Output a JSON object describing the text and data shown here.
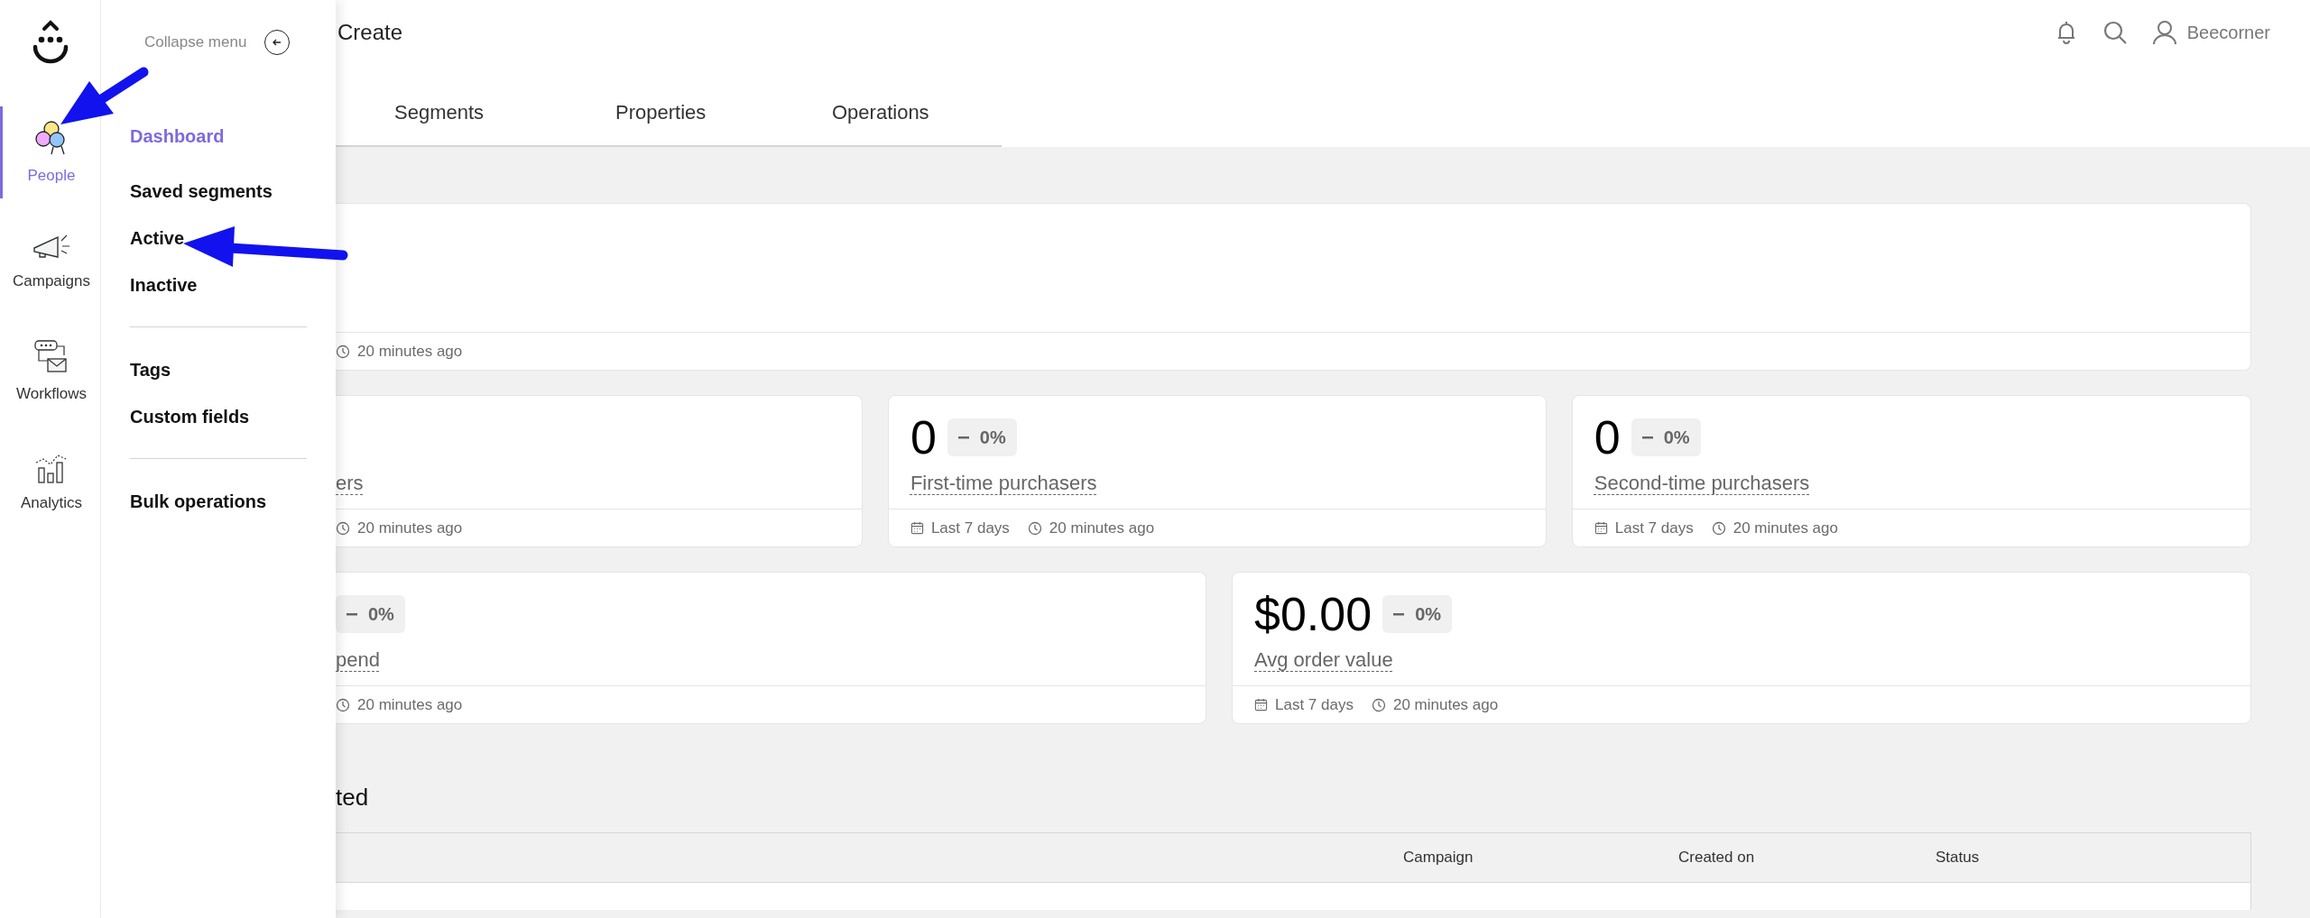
{
  "rail": [
    {
      "label": "People",
      "kind": "people",
      "selected": true
    },
    {
      "label": "Campaigns",
      "kind": "campaigns",
      "selected": false
    },
    {
      "label": "Workflows",
      "kind": "workflows",
      "selected": false
    },
    {
      "label": "Analytics",
      "kind": "analytics",
      "selected": false
    }
  ],
  "flyout": {
    "collapse_label": "Collapse menu",
    "groups": [
      [
        {
          "label": "Dashboard",
          "selected": true
        },
        {
          "label": "Saved segments",
          "selected": false
        },
        {
          "label": "Active",
          "selected": false
        },
        {
          "label": "Inactive",
          "selected": false
        }
      ],
      [
        {
          "label": "Tags",
          "selected": false
        },
        {
          "label": "Custom fields",
          "selected": false
        }
      ],
      [
        {
          "label": "Bulk operations",
          "selected": false
        }
      ]
    ]
  },
  "header": {
    "title": "Create",
    "user": "Beecorner"
  },
  "tabs": [
    {
      "label": "Segments",
      "selected": false
    },
    {
      "label": "Properties",
      "selected": false
    },
    {
      "label": "Operations",
      "selected": false
    }
  ],
  "card_rows": [
    [
      {
        "cut": true,
        "updated": "20 minutes ago"
      }
    ],
    [
      {
        "cut": true,
        "label": "ers",
        "updated": "20 minutes ago"
      },
      {
        "cut": false,
        "value": "0",
        "change": "0%",
        "label": "First-time purchasers",
        "period": "Last 7 days",
        "updated": "20 minutes ago"
      },
      {
        "cut": false,
        "value": "0",
        "change": "0%",
        "label": "Second-time purchasers",
        "period": "Last 7 days",
        "updated": "20 minutes ago"
      }
    ],
    [
      {
        "cut": true,
        "change": "0%",
        "label": "pend",
        "updated": "20 minutes ago"
      },
      {
        "cut": false,
        "value": "$0.00",
        "change": "0%",
        "label": "Avg order value",
        "period": "Last 7 days",
        "updated": "20 minutes ago"
      }
    ]
  ],
  "section_title": "ted",
  "table": {
    "columns": [
      "Campaign",
      "Created on",
      "Status"
    ]
  }
}
